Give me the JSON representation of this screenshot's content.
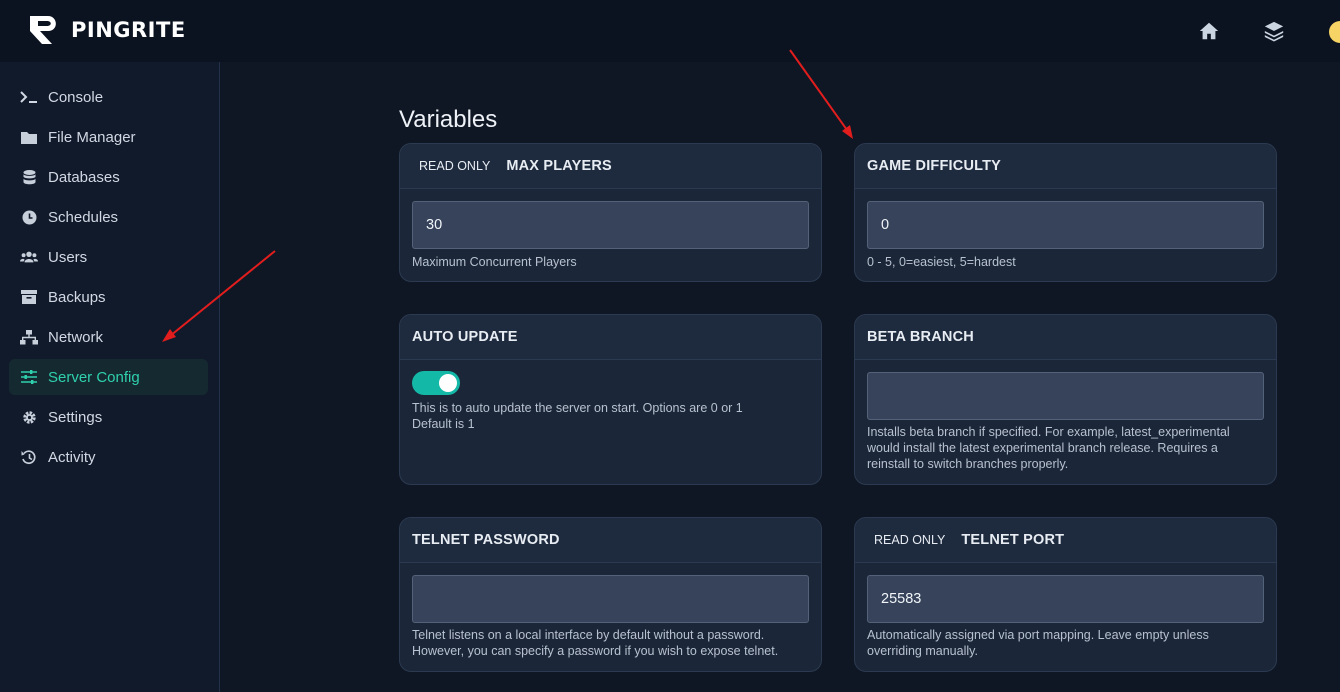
{
  "header": {
    "logo_text": "PINGRITE",
    "icons": [
      "home-icon",
      "layers-icon",
      "avatar-emoji"
    ]
  },
  "sidebar": {
    "items": [
      {
        "label": "Console",
        "icon": "terminal-icon",
        "active": false
      },
      {
        "label": "File Manager",
        "icon": "folder-icon",
        "active": false
      },
      {
        "label": "Databases",
        "icon": "database-icon",
        "active": false
      },
      {
        "label": "Schedules",
        "icon": "clock-icon",
        "active": false
      },
      {
        "label": "Users",
        "icon": "users-icon",
        "active": false
      },
      {
        "label": "Backups",
        "icon": "archive-icon",
        "active": false
      },
      {
        "label": "Network",
        "icon": "network-icon",
        "active": false
      },
      {
        "label": "Server Config",
        "icon": "sliders-icon",
        "active": true
      },
      {
        "label": "Settings",
        "icon": "gear-icon",
        "active": false
      },
      {
        "label": "Activity",
        "icon": "history-icon",
        "active": false
      }
    ]
  },
  "main": {
    "title": "Variables",
    "variables": [
      {
        "badge": "READ ONLY",
        "title": "MAX PLAYERS",
        "value": "30",
        "description": "Maximum Concurrent Players"
      },
      {
        "badge": "",
        "title": "GAME DIFFICULTY",
        "value": "0",
        "description": "0 - 5, 0=easiest, 5=hardest"
      },
      {
        "badge": "",
        "title": "AUTO UPDATE",
        "toggle_on": true,
        "description_line1": "This is to auto update the server on start. Options are 0 or 1",
        "description_line2": "Default is 1"
      },
      {
        "badge": "",
        "title": "BETA BRANCH",
        "value": "",
        "description_line1": "Installs beta branch if specified. For example, latest_experimental",
        "description_line2": "would install the latest experimental branch release. Requires a",
        "description_line3": "reinstall to switch branches properly."
      },
      {
        "badge": "",
        "title": "TELNET PASSWORD",
        "value": "",
        "description_line1": "Telnet listens on a local interface by default without a password.",
        "description_line2": "However, you can specify a password if you wish to expose telnet."
      },
      {
        "badge": "READ ONLY",
        "title": "TELNET PORT",
        "value": "25583",
        "description_line1": "Automatically assigned via port mapping. Leave empty unless",
        "description_line2": "overriding manually."
      }
    ]
  },
  "colors": {
    "accent": "#2fd0ae",
    "toggle": "#14b8a6",
    "annotation_arrow": "#e11d1d"
  }
}
